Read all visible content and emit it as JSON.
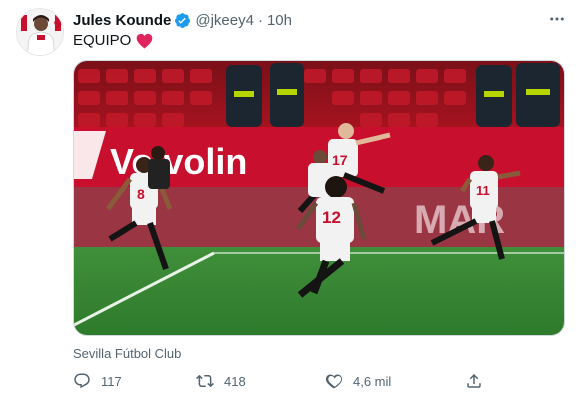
{
  "tweet": {
    "author_name": "Jules Kounde",
    "handle": "@jkeey4",
    "separator": "·",
    "time": "10h",
    "text": "EQUIPO",
    "text_emoji": "red-heart",
    "source": "Sevilla Fútbol Club",
    "verified": true
  },
  "media": {
    "description_icon": "football-celebration-photo",
    "board_text_left": "Volvolin",
    "board_text_right": "MAR",
    "shirt_numbers": [
      "8",
      "17",
      "12",
      "11"
    ]
  },
  "actions": {
    "reply_count": "117",
    "retweet_count": "418",
    "like_count": "4,6 mil"
  },
  "colors": {
    "verified": "#1d9bf0",
    "heart": "#e0245e",
    "muted": "#536471",
    "board_red": "#c8102e"
  }
}
